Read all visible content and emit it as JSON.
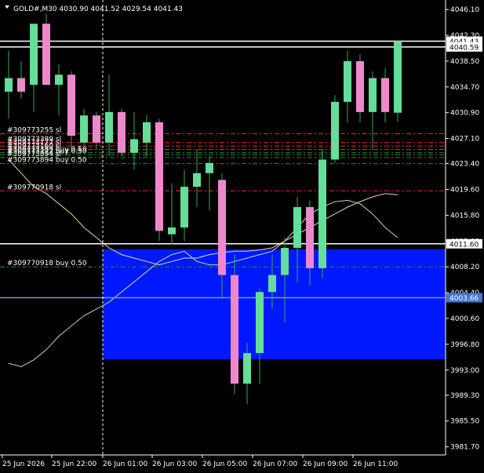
{
  "title": "GOLD#,M30  4030.90 4041.52 4029.54 4041.43",
  "colors": {
    "background": "#000000",
    "bull": "#66dd99",
    "bear": "#ee88cc",
    "wick": "#33aa55",
    "zone": "#0018ff",
    "ma_fast": "#b8d8a8",
    "ma_slow": "#e8d8a0",
    "order_line": "#ff2020",
    "buy_line": "#2a8a2a",
    "price_line": "#ffffff",
    "bid_line": "#7799cc",
    "bid_tag": "#4477cc"
  },
  "chart_data": {
    "type": "candlestick",
    "symbol": "GOLD#",
    "timeframe": "M30",
    "ohlc_header": [
      4030.9,
      4041.52,
      4029.54,
      4041.43
    ],
    "y_range": [
      3980.5,
      4047.5
    ],
    "y_ticks": [
      "4046.10",
      "4042.30",
      "4038.50",
      "4034.70",
      "4030.90",
      "4027.10",
      "4023.40",
      "4019.60",
      "4015.80",
      "4012.00",
      "4008.20",
      "4004.40",
      "4000.60",
      "3996.80",
      "3993.00",
      "3989.30",
      "3985.50",
      "3981.70"
    ],
    "x_ticks": [
      "25 Jun 2026",
      "25 Jun 22:00",
      "26 Jun 01:00",
      "26 Jun 03:00",
      "26 Jun 05:00",
      "26 Jun 07:00",
      "26 Jun 09:00",
      "26 Jun 11:00"
    ],
    "candles": [
      {
        "o": 4034.0,
        "h": 4040.0,
        "l": 4030.0,
        "c": 4036.0
      },
      {
        "o": 4036.0,
        "h": 4038.5,
        "l": 4033.0,
        "c": 4034.0
      },
      {
        "o": 4035.0,
        "h": 4044.0,
        "l": 4031.0,
        "c": 4044.0
      },
      {
        "o": 4044.0,
        "h": 4045.5,
        "l": 4035.0,
        "c": 4035.0
      },
      {
        "o": 4035.0,
        "h": 4038.0,
        "l": 4030.5,
        "c": 4036.5
      },
      {
        "o": 4036.5,
        "h": 4037.0,
        "l": 4025.5,
        "c": 4027.5
      },
      {
        "o": 4026.5,
        "h": 4031.5,
        "l": 4026.0,
        "c": 4030.5
      },
      {
        "o": 4030.5,
        "h": 4031.0,
        "l": 4025.5,
        "c": 4026.5
      },
      {
        "o": 4026.5,
        "h": 4036.5,
        "l": 4024.5,
        "c": 4031.0
      },
      {
        "o": 4031.0,
        "h": 4031.5,
        "l": 4024.5,
        "c": 4025.0
      },
      {
        "o": 4025.0,
        "h": 4031.0,
        "l": 4022.5,
        "c": 4027.0
      },
      {
        "o": 4026.5,
        "h": 4030.5,
        "l": 4024.5,
        "c": 4029.5
      },
      {
        "o": 4029.5,
        "h": 4030.0,
        "l": 4012.0,
        "c": 4013.5
      },
      {
        "o": 4013.0,
        "h": 4020.5,
        "l": 4011.5,
        "c": 4014.0
      },
      {
        "o": 4014.0,
        "h": 4022.5,
        "l": 4012.0,
        "c": 4020.0
      },
      {
        "o": 4020.0,
        "h": 4025.5,
        "l": 4017.0,
        "c": 4022.0
      },
      {
        "o": 4022.0,
        "h": 4024.5,
        "l": 4016.5,
        "c": 4023.5
      },
      {
        "o": 4021.0,
        "h": 4022.0,
        "l": 4003.5,
        "c": 4007.0
      },
      {
        "o": 4007.0,
        "h": 4010.0,
        "l": 3989.5,
        "c": 3991.0
      },
      {
        "o": 3991.0,
        "h": 3997.0,
        "l": 3988.0,
        "c": 3995.5
      },
      {
        "o": 3995.5,
        "h": 4005.0,
        "l": 3991.0,
        "c": 4004.5
      },
      {
        "o": 4004.5,
        "h": 4010.0,
        "l": 4002.0,
        "c": 4007.0
      },
      {
        "o": 4007.0,
        "h": 4012.5,
        "l": 4000.0,
        "c": 4011.0
      },
      {
        "o": 4011.0,
        "h": 4018.5,
        "l": 4006.0,
        "c": 4017.0
      },
      {
        "o": 4017.0,
        "h": 4018.0,
        "l": 4005.5,
        "c": 4008.0
      },
      {
        "o": 4008.0,
        "h": 4025.5,
        "l": 4006.5,
        "c": 4024.0
      },
      {
        "o": 4024.0,
        "h": 4033.5,
        "l": 4023.5,
        "c": 4032.5
      },
      {
        "o": 4032.5,
        "h": 4040.0,
        "l": 4029.5,
        "c": 4038.5
      },
      {
        "o": 4038.5,
        "h": 4039.5,
        "l": 4029.5,
        "c": 4031.0
      },
      {
        "o": 4031.0,
        "h": 4037.0,
        "l": 4025.5,
        "c": 4036.0
      },
      {
        "o": 4036.0,
        "h": 4037.5,
        "l": 4029.5,
        "c": 4031.0
      },
      {
        "o": 4030.9,
        "h": 4041.52,
        "l": 4029.54,
        "c": 4041.43
      }
    ],
    "zone": {
      "from_candle": 0,
      "to_candle": 31,
      "top": 4010.8,
      "bottom": 3994.6
    },
    "ma_fast": [
      3994.0,
      3993.5,
      3994.5,
      3996.0,
      3998.0,
      3999.5,
      4001.0,
      4002.0,
      4003.0,
      4004.5,
      4006.0,
      4007.5,
      4009.0,
      4010.0,
      4010.5,
      4009.0,
      4008.5,
      4008.5,
      4009.0,
      4009.5,
      4010.0,
      4010.5,
      4012.0,
      4014.0,
      4016.0,
      4017.0,
      4017.8,
      4018.0,
      4017.5,
      4016.0,
      4014.0,
      4012.5
    ],
    "ma_slow": [
      4024.0,
      4022.0,
      4020.0,
      4019.0,
      4017.5,
      4016.0,
      4014.0,
      4012.5,
      4011.0,
      4010.0,
      4009.5,
      4009.0,
      4008.5,
      4009.0,
      4009.5,
      4009.5,
      4010.0,
      4010.3,
      4010.5,
      4010.5,
      4010.7,
      4011.0,
      4012.0,
      4013.0,
      4014.0,
      4015.0,
      4016.0,
      4017.0,
      4017.8,
      4018.5,
      4019.0,
      4018.8
    ],
    "order_lines": [
      {
        "price": 4027.8,
        "color": "#ff2020",
        "label": "#309773255 sl"
      },
      {
        "price": 4026.5,
        "color": "#ff2020",
        "label": "#309773389 sl"
      },
      {
        "price": 4026.0,
        "color": "#ff2020",
        "label": "#309773172 sl"
      },
      {
        "price": 4025.5,
        "color": "#ff2020",
        "label": "#309773160 sl"
      },
      {
        "price": 4025.0,
        "color": "#2a8a2a",
        "label": "#309773389 buy 0.50"
      },
      {
        "price": 4024.7,
        "color": "#2a8a2a",
        "label": "#309773172 buy 0.50"
      },
      {
        "price": 4024.3,
        "color": "#2a8a2a",
        "label": "#309773894 sl"
      },
      {
        "price": 4023.4,
        "color": "#2a8a2a",
        "label": "#309773894 buy 0.50"
      },
      {
        "price": 4019.4,
        "color": "#ff2020",
        "label": "#309770918 sl"
      },
      {
        "price": 4008.2,
        "color": "#2a8a2a",
        "label": "#309770918 buy 0.50"
      }
    ],
    "price_lines": [
      {
        "price": 4041.43,
        "color": "#ffffff",
        "tag": "4041.43",
        "tag_bg": "#ffffff",
        "tag_fg": "#000000"
      },
      {
        "price": 4040.59,
        "color": "#ffffff",
        "tag": "4040.59",
        "tag_bg": "#ffffff",
        "tag_fg": "#000000"
      },
      {
        "price": 4011.6,
        "color": "#ffffff",
        "tag": "4011.60",
        "tag_bg": "#ffffff",
        "tag_fg": "#000000"
      },
      {
        "price": 4003.66,
        "color": "#7799cc",
        "tag": "4003.66",
        "tag_bg": "#4477cc",
        "tag_fg": "#ffffff"
      }
    ],
    "grid": false
  }
}
